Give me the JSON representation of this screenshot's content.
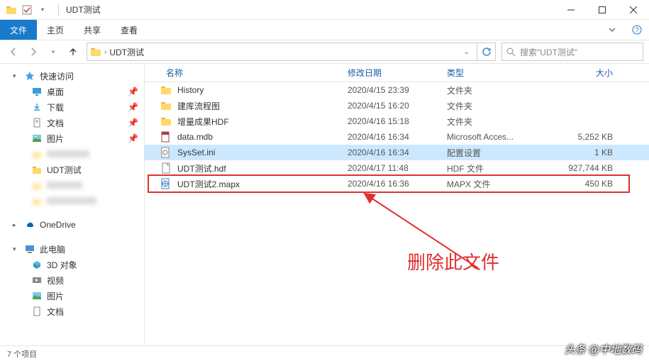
{
  "window": {
    "title": "UDT测试",
    "min_tip": "最小化",
    "max_tip": "最大化",
    "close_tip": "关闭"
  },
  "ribbon": {
    "file": "文件",
    "home": "主页",
    "share": "共享",
    "view": "查看"
  },
  "address": {
    "crumb_root": "UDT测试",
    "search_placeholder": "搜索\"UDT测试\""
  },
  "nav": {
    "quick_access": "快速访问",
    "desktop": "桌面",
    "downloads": "下载",
    "documents": "文档",
    "pictures": "图片",
    "udt_test": "UDT测试",
    "onedrive": "OneDrive",
    "this_pc": "此电脑",
    "objects_3d": "3D 对象",
    "videos": "视频",
    "pictures2": "图片",
    "documents2": "文档"
  },
  "columns": {
    "name": "名称",
    "date": "修改日期",
    "type": "类型",
    "size": "大小"
  },
  "files": [
    {
      "name": "History",
      "date": "2020/4/15 23:39",
      "type": "文件夹",
      "size": "",
      "icon": "folder"
    },
    {
      "name": "建库流程图",
      "date": "2020/4/15 16:20",
      "type": "文件夹",
      "size": "",
      "icon": "folder"
    },
    {
      "name": "增量成果HDF",
      "date": "2020/4/16 15:18",
      "type": "文件夹",
      "size": "",
      "icon": "folder"
    },
    {
      "name": "data.mdb",
      "date": "2020/4/16 16:34",
      "type": "Microsoft Acces...",
      "size": "5,252 KB",
      "icon": "mdb"
    },
    {
      "name": "SysSet.ini",
      "date": "2020/4/16 16:34",
      "type": "配置设置",
      "size": "1 KB",
      "icon": "ini",
      "selected": true
    },
    {
      "name": "UDT测试.hdf",
      "date": "2020/4/17 11:48",
      "type": "HDF 文件",
      "size": "927,744 KB",
      "icon": "file"
    },
    {
      "name": "UDT测试2.mapx",
      "date": "2020/4/16 16:36",
      "type": "MAPX 文件",
      "size": "450 KB",
      "icon": "mapx"
    }
  ],
  "status": {
    "item_count": "7 个项目"
  },
  "annotation": {
    "text": "删除此文件"
  },
  "watermark": "头条 @中地数码"
}
